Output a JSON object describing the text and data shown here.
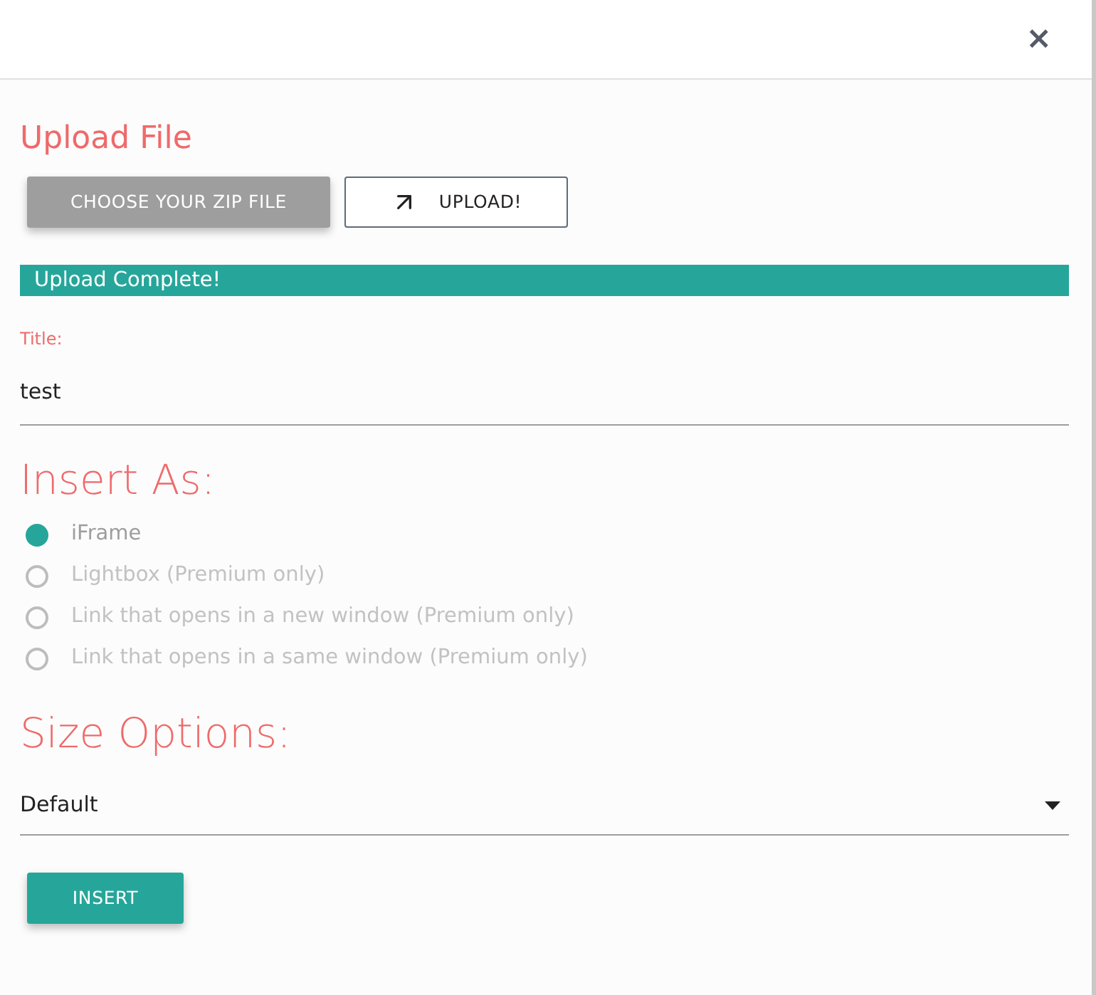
{
  "dialog": {
    "close": "×"
  },
  "upload": {
    "heading": "Upload File",
    "choose_button": "CHOOSE YOUR ZIP FILE",
    "upload_button": "UPLOAD!",
    "status_banner": "Upload Complete!"
  },
  "title_field": {
    "label": "Title:",
    "value": "test"
  },
  "insert_as": {
    "heading": "Insert As:",
    "options": [
      {
        "label": "iFrame",
        "selected": true,
        "disabled": false
      },
      {
        "label": "Lightbox (Premium only)",
        "selected": false,
        "disabled": true
      },
      {
        "label": "Link that opens in a new window (Premium only)",
        "selected": false,
        "disabled": true
      },
      {
        "label": "Link that opens in a same window (Premium only)",
        "selected": false,
        "disabled": true
      }
    ]
  },
  "size_options": {
    "heading": "Size Options:",
    "value": "Default"
  },
  "insert_button": "INSERT"
}
